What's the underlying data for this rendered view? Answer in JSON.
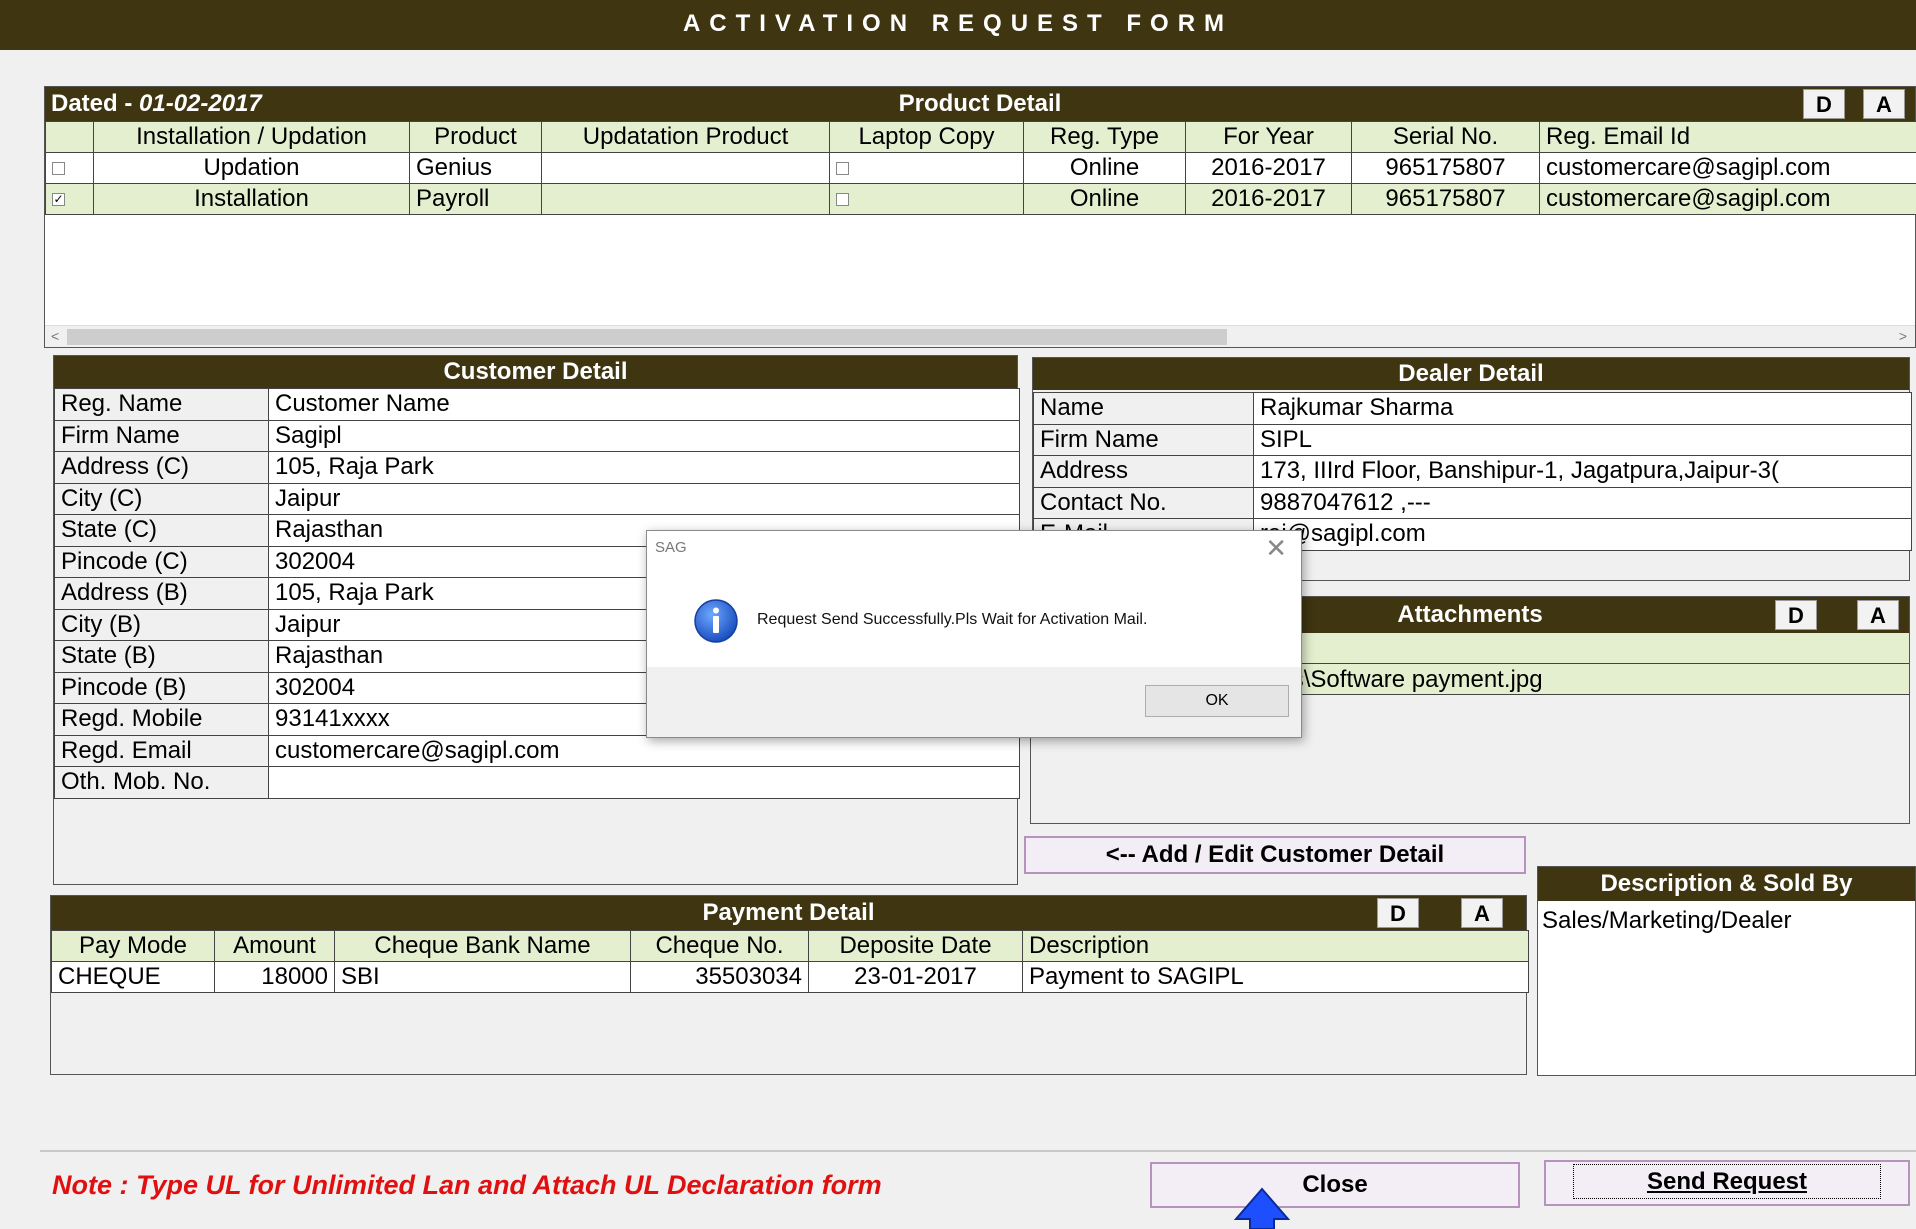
{
  "title": "ACTIVATION REQUEST FORM",
  "product": {
    "dated_label": "Dated - ",
    "dated_value": "01-02-2017",
    "heading": "Product Detail",
    "btn_d": "D",
    "btn_a": "A",
    "columns": [
      "Installation / Updation",
      "Product",
      "Updatation Product",
      "Laptop Copy",
      "Reg. Type",
      "For Year",
      "Serial No.",
      "Reg. Email Id"
    ],
    "rows": [
      {
        "checked": false,
        "type": "Updation",
        "product": "Genius",
        "upd_product": "",
        "reg_type": "Online",
        "year": "2016-2017",
        "serial": "965175807",
        "email": "customercare@sagipl.com"
      },
      {
        "checked": true,
        "type": "Installation",
        "product": "Payroll",
        "upd_product": "",
        "reg_type": "Online",
        "year": "2016-2017",
        "serial": "965175807",
        "email": "customercare@sagipl.com"
      }
    ]
  },
  "customer": {
    "heading": "Customer Detail",
    "fields": [
      {
        "label": "Reg. Name",
        "value": "Customer Name"
      },
      {
        "label": "Firm Name",
        "value": "Sagipl"
      },
      {
        "label": "Address (C)",
        "value": "105, Raja Park"
      },
      {
        "label": "City (C)",
        "value": "Jaipur"
      },
      {
        "label": "State (C)",
        "value": "Rajasthan"
      },
      {
        "label": "Pincode (C)",
        "value": "302004"
      },
      {
        "label": "Address (B)",
        "value": "105, Raja Park"
      },
      {
        "label": "City (B)",
        "value": "Jaipur"
      },
      {
        "label": "State (B)",
        "value": "Rajasthan"
      },
      {
        "label": "Pincode (B)",
        "value": "302004"
      },
      {
        "label": "Regd. Mobile",
        "value": "93141xxxx"
      },
      {
        "label": "Regd. Email",
        "value": "customercare@sagipl.com"
      },
      {
        "label": "Oth. Mob. No.",
        "value": ""
      }
    ]
  },
  "dealer": {
    "heading": "Dealer Detail",
    "fields": [
      {
        "label": "Name",
        "value": "Rajkumar Sharma"
      },
      {
        "label": "Firm Name",
        "value": "SIPL"
      },
      {
        "label": "Address",
        "value": "173, IIIrd Floor, Banshipur-1, Jagatpura,Jaipur-3("
      },
      {
        "label": "Contact No.",
        "value": "9887047612 ,---"
      },
      {
        "label": "E-Mail",
        "value": "raj@sagipl.com"
      }
    ]
  },
  "attachments": {
    "heading": "Attachments",
    "btn_d": "D",
    "btn_a": "A",
    "column": "Attachment",
    "rows": [
      "C:\\Users\\s84\\Documents\\Software payment.jpg"
    ]
  },
  "add_edit_button": "<-- Add / Edit Customer Detail",
  "description": {
    "heading": "Description & Sold By",
    "value": "Sales/Marketing/Dealer"
  },
  "payment": {
    "heading": "Payment Detail",
    "btn_d": "D",
    "btn_a": "A",
    "columns": [
      "Pay Mode",
      "Amount",
      "Cheque Bank Name",
      "Cheque No.",
      "Deposite Date",
      "Description"
    ],
    "rows": [
      {
        "mode": "CHEQUE",
        "amount": "18000",
        "bank": "SBI",
        "cheque": "35503034",
        "date": "23-01-2017",
        "desc": "Payment to SAGIPL"
      }
    ]
  },
  "note": "Note : Type UL for Unlimited Lan and Attach UL Declaration form",
  "close_button": "Close",
  "send_button": "Send Request",
  "dialog": {
    "title": "SAG",
    "close_glyph": "✕",
    "message": "Request Send Successfully.Pls Wait for Activation Mail.",
    "ok": "OK"
  },
  "colors": {
    "header_bg": "#3f3511",
    "row_highlight": "#e4efcf",
    "note_red": "#e01010",
    "pointer_arrow": "#1e4fff"
  }
}
